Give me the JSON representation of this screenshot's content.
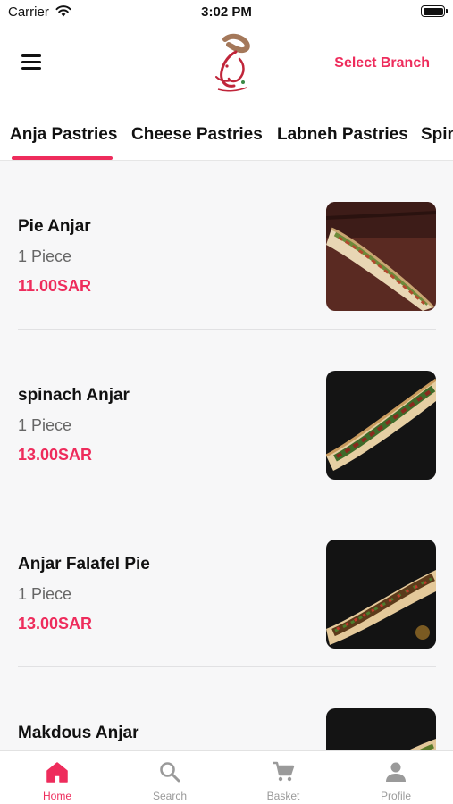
{
  "status_bar": {
    "carrier": "Carrier",
    "time": "3:02 PM"
  },
  "header": {
    "select_branch": "Select Branch",
    "accent_color": "#ee2c5c"
  },
  "tabs": [
    {
      "label": "Anja Pastries",
      "active": true
    },
    {
      "label": "Cheese Pastries",
      "active": false
    },
    {
      "label": "Labneh Pastries",
      "active": false
    },
    {
      "label": "Spin",
      "active": false
    }
  ],
  "items": [
    {
      "name": "Pie Anjar",
      "quantity": "1 Piece",
      "price": "11.00SAR",
      "image": "pie-anjar-photo"
    },
    {
      "name": "spinach Anjar",
      "quantity": "1 Piece",
      "price": "13.00SAR",
      "image": "spinach-anjar-photo"
    },
    {
      "name": "Anjar Falafel Pie",
      "quantity": "1 Piece",
      "price": "13.00SAR",
      "image": "falafel-pie-photo"
    },
    {
      "name": "Makdous Anjar",
      "quantity": "",
      "price": "",
      "image": "makdous-anjar-photo"
    }
  ],
  "bottom_nav": [
    {
      "label": "Home",
      "icon": "home-icon",
      "active": true
    },
    {
      "label": "Search",
      "icon": "search-icon",
      "active": false
    },
    {
      "label": "Basket",
      "icon": "cart-icon",
      "active": false
    },
    {
      "label": "Profile",
      "icon": "profile-icon",
      "active": false
    }
  ]
}
